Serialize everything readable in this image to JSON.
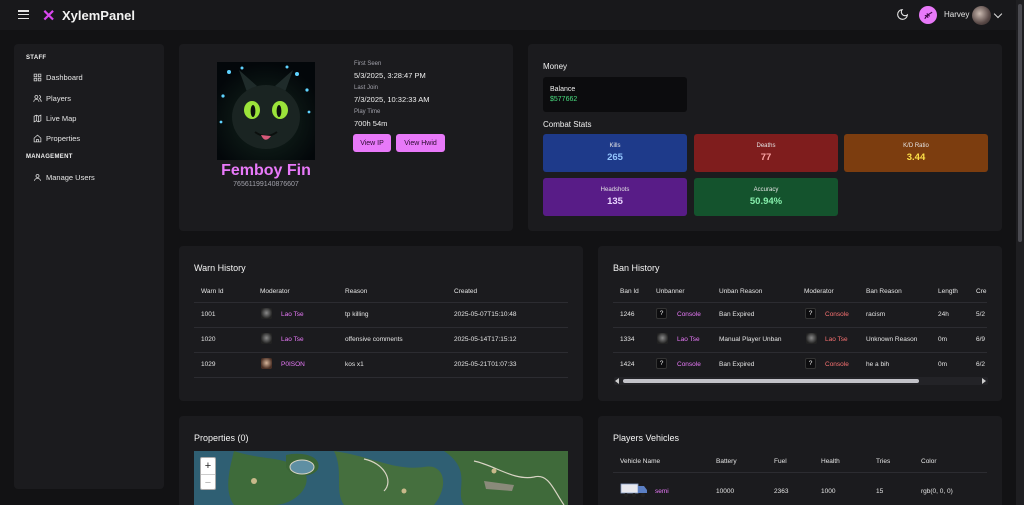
{
  "app": {
    "title": "XylemPanel",
    "logo_glyph": "✕",
    "accent": "#e879f9"
  },
  "topbar": {
    "theme_icon": "moon-icon",
    "user_name": "Harvey"
  },
  "sidebar": {
    "staff_heading": "STAFF",
    "management_heading": "MANAGEMENT",
    "items": [
      {
        "label": "Dashboard",
        "icon": "grid-icon"
      },
      {
        "label": "Players",
        "icon": "users-icon"
      },
      {
        "label": "Live Map",
        "icon": "map-icon"
      },
      {
        "label": "Properties",
        "icon": "home-icon"
      },
      {
        "label": "Manage Users",
        "icon": "user-icon"
      }
    ]
  },
  "profile": {
    "name": "Femboy Fin",
    "steam_id": "76561199140876607",
    "first_seen_label": "First Seen",
    "first_seen": "5/3/2025, 3:28:47 PM",
    "last_join_label": "Last Join",
    "last_join": "7/3/2025, 10:32:33 AM",
    "play_time_label": "Play Time",
    "play_time": "700h 54m",
    "view_ip_label": "View IP",
    "view_hwid_label": "View Hwid"
  },
  "money": {
    "title": "Money",
    "balance_label": "Balance",
    "balance_value": "$577662"
  },
  "combat": {
    "title": "Combat Stats",
    "kills_label": "Kills",
    "kills": "265",
    "deaths_label": "Deaths",
    "deaths": "77",
    "kd_label": "K/D Ratio",
    "kd": "3.44",
    "headshots_label": "Headshots",
    "headshots": "135",
    "accuracy_label": "Accuracy",
    "accuracy": "50.94%",
    "colors": {
      "kills": "#1e3a8a",
      "deaths": "#7f1d1d",
      "kd": "#7c3d0f",
      "headshots": "#581c87",
      "accuracy": "#14532d"
    }
  },
  "warn_history": {
    "title": "Warn History",
    "headers": [
      "Warn Id",
      "Moderator",
      "Reason",
      "Created"
    ],
    "rows": [
      {
        "id": "1001",
        "moderator": "Lao Tse",
        "reason": "tp killing",
        "created": "2025-05-07T15:10:48"
      },
      {
        "id": "1020",
        "moderator": "Lao Tse",
        "reason": "offensive comments",
        "created": "2025-05-14T17:15:12"
      },
      {
        "id": "1029",
        "moderator": "P0ISON",
        "reason": "kos x1",
        "created": "2025-05-21T01:07:33"
      }
    ]
  },
  "ban_history": {
    "title": "Ban History",
    "headers": [
      "Ban Id",
      "Unbanner",
      "Unban Reason",
      "Moderator",
      "Ban Reason",
      "Length",
      "Cre"
    ],
    "rows": [
      {
        "id": "1246",
        "unbanner": "Console",
        "unban_reason": "Ban Expired",
        "moderator": "Console",
        "ban_reason": "racism",
        "length": "24h",
        "created": "5/2"
      },
      {
        "id": "1334",
        "unbanner": "Lao Tse",
        "unban_reason": "Manual Player Unban",
        "moderator": "Lao Tse",
        "ban_reason": "Unknown Reason",
        "length": "0m",
        "created": "6/9"
      },
      {
        "id": "1424",
        "unbanner": "Console",
        "unban_reason": "Ban Expired",
        "moderator": "Console",
        "ban_reason": "he a bih",
        "length": "0m",
        "created": "6/2"
      }
    ],
    "unknown_avatar_glyph": "?"
  },
  "properties": {
    "title": "Properties (0)",
    "zoom_in": "+",
    "zoom_out": "−"
  },
  "vehicles": {
    "title": "Players Vehicles",
    "headers": [
      "Vehicle Name",
      "Battery",
      "Fuel",
      "Health",
      "Tries",
      "Color"
    ],
    "rows": [
      {
        "name": "semi",
        "battery": "10000",
        "fuel": "2363",
        "health": "1000",
        "tries": "15",
        "color": "rgb(0, 0, 0)"
      }
    ]
  }
}
